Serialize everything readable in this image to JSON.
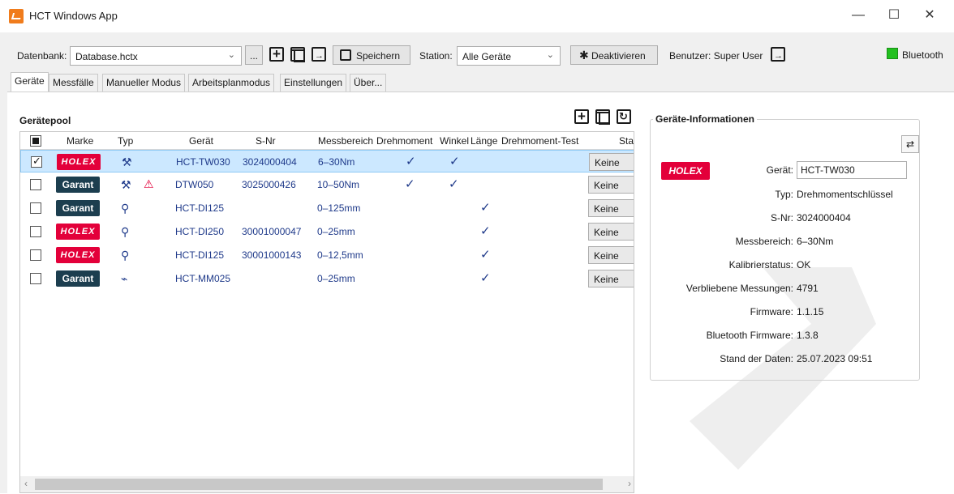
{
  "window": {
    "title": "HCT Windows App",
    "minimize": "—",
    "maximize": "☐",
    "close": "✕"
  },
  "toolbar": {
    "database_label": "Datenbank:",
    "database_value": "Database.hctx",
    "browse_label": "...",
    "save_label": "Speichern",
    "station_label": "Station:",
    "station_value": "Alle Geräte",
    "deactivate_label": "Deaktivieren",
    "user_label": "Benutzer: Super User",
    "bluetooth_label": "Bluetooth",
    "bluetooth_status_color": "#22c01f"
  },
  "tabs": [
    "Geräte",
    "Messfälle",
    "Manueller Modus",
    "Arbeitsplanmodus",
    "Einstellungen",
    "Über..."
  ],
  "geraetepool": {
    "title": "Gerätepool",
    "columns": [
      "Marke",
      "Typ",
      "Gerät",
      "S-Nr",
      "Messbereich",
      "Drehmoment",
      "Winkel",
      "Länge",
      "Drehmoment-Test",
      "Stati"
    ],
    "rows": [
      {
        "checked": true,
        "brand": "HOLEX",
        "type_icon": "wrench-icon",
        "warning": false,
        "geraet": "HCT-TW030",
        "snr": "3024000404",
        "messbereich": "6–30Nm",
        "drehmoment": true,
        "winkel": true,
        "laenge": false,
        "status": "Keine",
        "selected": true
      },
      {
        "checked": false,
        "brand": "Garant",
        "type_icon": "wrench-icon",
        "warning": true,
        "geraet": "DTW050",
        "snr": "3025000426",
        "messbereich": "10–50Nm",
        "drehmoment": true,
        "winkel": true,
        "laenge": false,
        "status": "Keine",
        "selected": false
      },
      {
        "checked": false,
        "brand": "Garant",
        "type_icon": "dial-indicator-icon",
        "warning": false,
        "geraet": "HCT-DI125",
        "snr": "",
        "messbereich": "0–125mm",
        "drehmoment": false,
        "winkel": false,
        "laenge": true,
        "status": "Keine",
        "selected": false
      },
      {
        "checked": false,
        "brand": "HOLEX",
        "type_icon": "dial-indicator-icon",
        "warning": false,
        "geraet": "HCT-DI250",
        "snr": "30001000047",
        "messbereich": "0–25mm",
        "drehmoment": false,
        "winkel": false,
        "laenge": true,
        "status": "Keine",
        "selected": false
      },
      {
        "checked": false,
        "brand": "HOLEX",
        "type_icon": "dial-indicator-icon",
        "warning": false,
        "geraet": "HCT-DI125",
        "snr": "30001000143",
        "messbereich": "0–12,5mm",
        "drehmoment": false,
        "winkel": false,
        "laenge": true,
        "status": "Keine",
        "selected": false
      },
      {
        "checked": false,
        "brand": "Garant",
        "type_icon": "micrometer-icon",
        "warning": false,
        "geraet": "HCT-MM025",
        "snr": "",
        "messbereich": "0–25mm",
        "drehmoment": false,
        "winkel": false,
        "laenge": true,
        "status": "Keine",
        "selected": false
      }
    ]
  },
  "info": {
    "title": "Geräte-Informationen",
    "brand": "HOLEX",
    "geraet_label": "Gerät:",
    "geraet_value": "HCT-TW030",
    "fields": [
      {
        "label": "Typ:",
        "value": "Drehmomentschlüssel"
      },
      {
        "label": "S-Nr:",
        "value": "3024000404"
      },
      {
        "label": "Messbereich:",
        "value": "6–30Nm"
      },
      {
        "label": "Kalibrierstatus:",
        "value": "OK"
      },
      {
        "label": "Verbliebene Messungen:",
        "value": "4791"
      },
      {
        "label": "Firmware:",
        "value": "1.1.15"
      },
      {
        "label": "Bluetooth Firmware:",
        "value": "1.3.8"
      },
      {
        "label": "Stand der Daten:",
        "value": "25.07.2023 09:51"
      }
    ]
  }
}
